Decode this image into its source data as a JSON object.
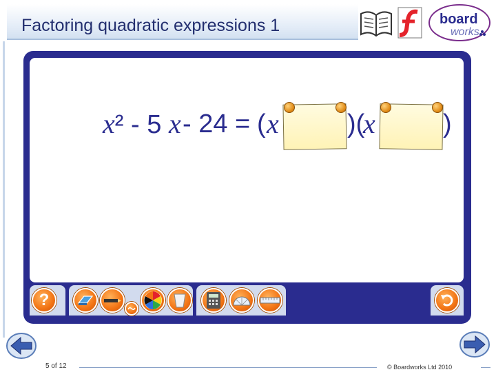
{
  "header": {
    "title": "Factoring quadratic expressions 1"
  },
  "logo": {
    "brand_top": "board",
    "brand_bottom": "works",
    "brand_color": "#2a2c8f",
    "accent_color": "#e4232b"
  },
  "equation": {
    "term1": "x² - 5",
    "var1": "x",
    "term2": " - 24 =",
    "open1": "(",
    "var2": "x",
    "close_open": ")(",
    "var3": "x",
    "close2": ")"
  },
  "toolbar": {
    "help_label": "?",
    "icons": [
      "help-icon",
      "eraser-icon",
      "pen-icon",
      "color-wheel-icon",
      "bin-icon",
      "calculator-icon",
      "protractor-icon",
      "ruler-icon",
      "undo-icon"
    ]
  },
  "footer": {
    "slide_counter": "5 of 12",
    "copyright": "© Boardworks Ltd 2010"
  },
  "colors": {
    "panel": "#2a2c8f",
    "tool_orange": "#f27414",
    "title": "#232f6f"
  }
}
